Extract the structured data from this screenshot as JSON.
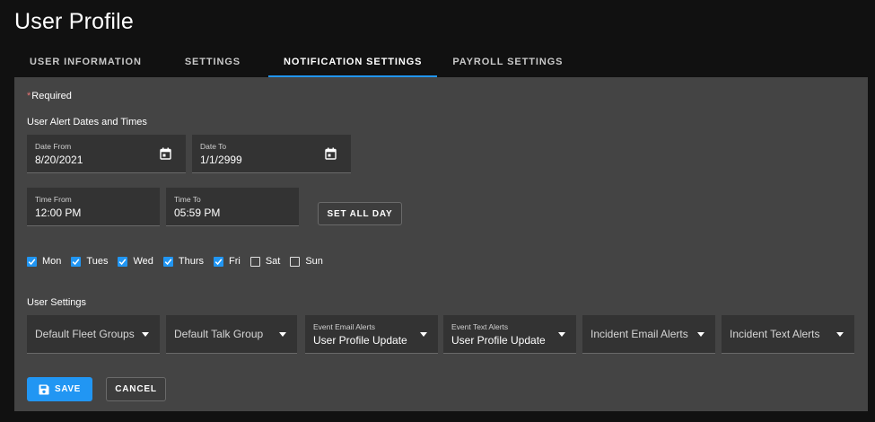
{
  "page": {
    "title": "User Profile"
  },
  "tabs": [
    {
      "label": "USER INFORMATION",
      "active": false
    },
    {
      "label": "SETTINGS",
      "active": false
    },
    {
      "label": "NOTIFICATION SETTINGS",
      "active": true
    },
    {
      "label": "PAYROLL SETTINGS",
      "active": false
    }
  ],
  "form": {
    "required_star": "*",
    "required_text": "Required",
    "alert_section_title": "User Alert Dates and Times",
    "date_from": {
      "label": "Date From",
      "value": "8/20/2021"
    },
    "date_to": {
      "label": "Date To",
      "value": "1/1/2999"
    },
    "time_from": {
      "label": "Time From",
      "value": "12:00 PM"
    },
    "time_to": {
      "label": "Time To",
      "value": "05:59 PM"
    },
    "set_all_day_label": "SET ALL DAY",
    "days": [
      {
        "label": "Mon",
        "checked": true
      },
      {
        "label": "Tues",
        "checked": true
      },
      {
        "label": "Wed",
        "checked": true
      },
      {
        "label": "Thurs",
        "checked": true
      },
      {
        "label": "Fri",
        "checked": true
      },
      {
        "label": "Sat",
        "checked": false
      },
      {
        "label": "Sun",
        "checked": false
      }
    ],
    "user_settings_title": "User Settings",
    "default_fleet_groups": {
      "placeholder": "Default Fleet Groups"
    },
    "default_talk_group": {
      "placeholder": "Default Talk Group"
    },
    "event_email_alerts": {
      "label": "Event Email Alerts",
      "value": "User Profile Update"
    },
    "event_text_alerts": {
      "label": "Event Text Alerts",
      "value": "User Profile Update"
    },
    "incident_email_alerts": {
      "placeholder": "Incident Email Alerts"
    },
    "incident_text_alerts": {
      "placeholder": "Incident Text Alerts"
    },
    "save_label": "SAVE",
    "cancel_label": "CANCEL"
  },
  "colors": {
    "accent": "#2196f3",
    "background": "#111111",
    "panel": "#444444",
    "field": "#333333",
    "required_star": "#e57373"
  },
  "icons": {
    "date_from": "calendar-icon",
    "date_to": "calendar-icon",
    "save": "floppy-disk-icon",
    "checkbox": "checkmark-icon",
    "dropdown": "caret-down-icon"
  }
}
